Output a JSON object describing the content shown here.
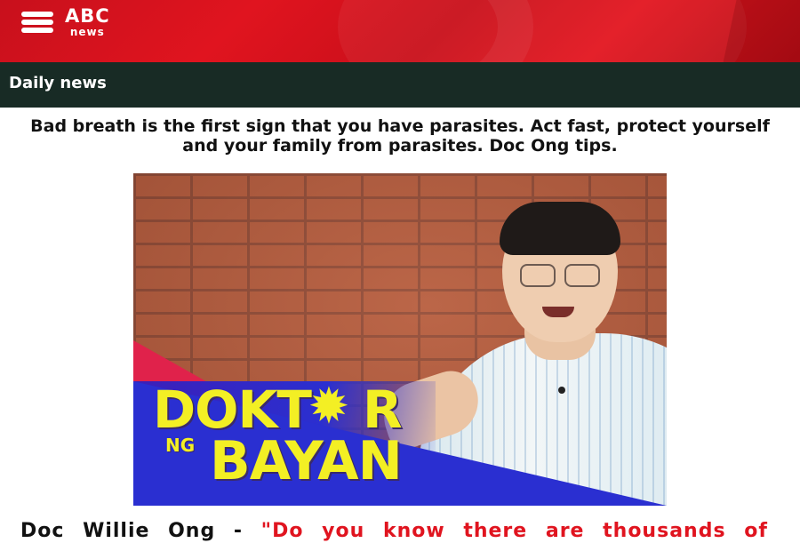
{
  "header": {
    "logo_top": "ABC",
    "logo_bottom": "news",
    "menu_icon": "hamburger-menu-icon",
    "brand_color": "#e0141f"
  },
  "section": {
    "title": "Daily news",
    "bar_color": "#182b25"
  },
  "article": {
    "headline": "Bad breath is the first sign that you have parasites. Act fast, protect yourself and your family from parasites. Doc Ong tips.",
    "image": {
      "overlay_line1": "DOKT",
      "overlay_line1_after": "R",
      "overlay_ng": "NG",
      "overlay_line2": "BAYAN"
    },
    "body_author": "Doc Willie Ong -",
    "body_quote": "\"Do you know there are thousands of parasites all"
  }
}
